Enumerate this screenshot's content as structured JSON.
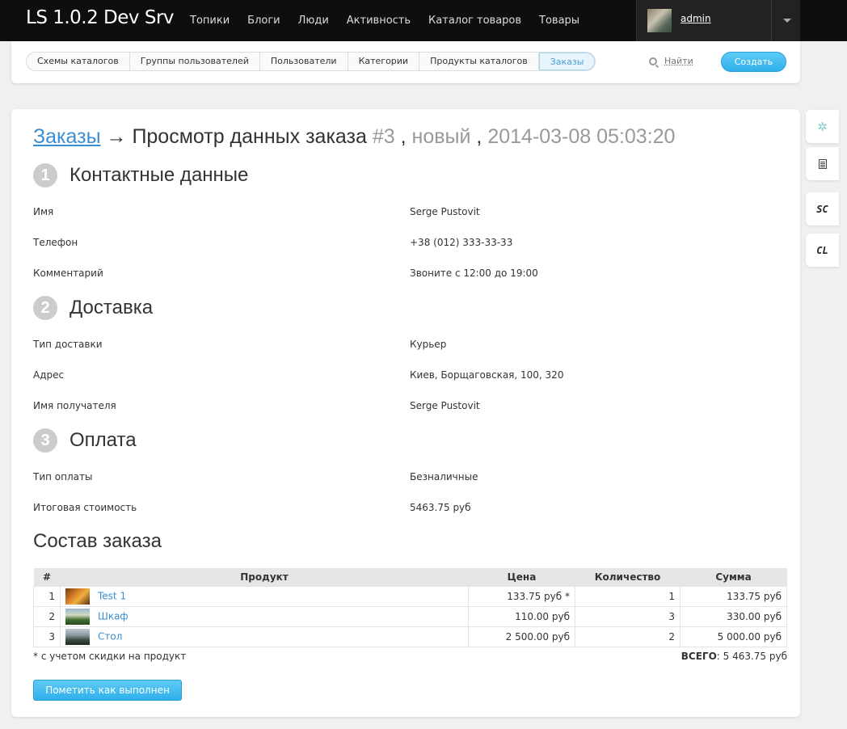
{
  "navbar": {
    "brand": "LS 1.0.2 Dev Srv",
    "links": [
      "Топики",
      "Блоги",
      "Люди",
      "Активность",
      "Каталог товаров",
      "Товары"
    ],
    "username": "admin"
  },
  "subnav": {
    "tabs": [
      "Схемы каталогов",
      "Группы пользователей",
      "Пользователи",
      "Категории",
      "Продукты каталогов",
      "Заказы"
    ],
    "active_tab": "Заказы",
    "find_label": "Найти",
    "create_label": "Создать"
  },
  "title": {
    "link": "Заказы",
    "arrow_text": " → Просмотр данных заказа ",
    "order_num": "#3",
    "sep1": " , ",
    "status": "новый",
    "sep2": " , ",
    "datetime": "2014-03-08 05:03:20"
  },
  "sections": {
    "contact": {
      "num": "1",
      "title": "Контактные данные",
      "rows": [
        {
          "k": "Имя",
          "v": "Serge Pustovit"
        },
        {
          "k": "Телефон",
          "v": "+38 (012) 333-33-33"
        },
        {
          "k": "Комментарий",
          "v": "Звоните с 12:00 до 19:00"
        }
      ]
    },
    "delivery": {
      "num": "2",
      "title": "Доставка",
      "rows": [
        {
          "k": "Тип доставки",
          "v": "Курьер"
        },
        {
          "k": "Адрес",
          "v": "Киев, Борщаговская, 100, 320"
        },
        {
          "k": "Имя получателя",
          "v": "Serge Pustovit"
        }
      ]
    },
    "payment": {
      "num": "3",
      "title": "Оплата",
      "rows": [
        {
          "k": "Тип оплаты",
          "v": "Безналичные"
        },
        {
          "k": "Итоговая стоимость",
          "v": "5463.75 руб"
        }
      ]
    }
  },
  "order": {
    "title": "Состав заказа",
    "columns": [
      "#",
      "Продукт",
      "Цена",
      "Количество",
      "Сумма"
    ],
    "items": [
      {
        "num": "1",
        "name": "Test 1",
        "price": "133.75 руб *",
        "qty": "1",
        "sum": "133.75 руб"
      },
      {
        "num": "2",
        "name": "Шкаф",
        "price": "110.00 руб",
        "qty": "3",
        "sum": "330.00 руб"
      },
      {
        "num": "3",
        "name": "Стол",
        "price": "2 500.00 руб",
        "qty": "2",
        "sum": "5 000.00 руб"
      }
    ],
    "footnote": "* с учетом скидки на продукт",
    "total_label": "ВСЕГО",
    "total_value": ": 5 463.75 руб",
    "mark_done_label": "Пометить как выполнен"
  },
  "side_widgets": {
    "sc_label": "SC",
    "cl_label": "CL"
  }
}
